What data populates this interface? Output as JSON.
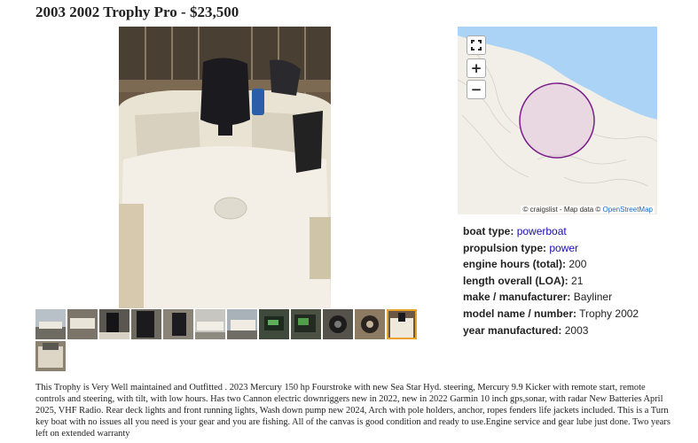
{
  "listing": {
    "title": "2003 2002 Trophy Pro - $23,500"
  },
  "map": {
    "attribution_prefix": "© craigslist - Map data © ",
    "attribution_link": "OpenStreetMap"
  },
  "attributes": [
    {
      "key": "boat type:",
      "value": "powerboat",
      "link": true
    },
    {
      "key": "propulsion type:",
      "value": "power",
      "link": true
    },
    {
      "key": "engine hours (total):",
      "value": "200",
      "link": false
    },
    {
      "key": "length overall (LOA):",
      "value": "21",
      "link": false
    },
    {
      "key": "make / manufacturer:",
      "value": "Bayliner",
      "link": false
    },
    {
      "key": "model name / number:",
      "value": "Trophy 2002",
      "link": false
    },
    {
      "key": "year manufactured:",
      "value": "2003",
      "link": false
    }
  ],
  "description": "This Trophy is Very Well maintained and Outfitted . 2023 Mercury 150 hp Fourstroke with new Sea Star Hyd. steering, Mercury 9.9 Kicker with remote start, remote controls and steering, with tilt, with low hours. Has two Cannon electric downriggers new in 2022, new in 2022 Garmin 10 inch gps,sonar, with radar New Batteries April 2025, VHF Radio. Rear deck lights and front running lights, Wash down pump new 2024, Arch with pole holders, anchor, ropes fenders life jackets included. This is a Turn key boat with no issues all you need is your gear and you are fishing. All of the canvas is good condition and ready to use.Engine service and gear lube just done. Two years left on extended warranty"
}
